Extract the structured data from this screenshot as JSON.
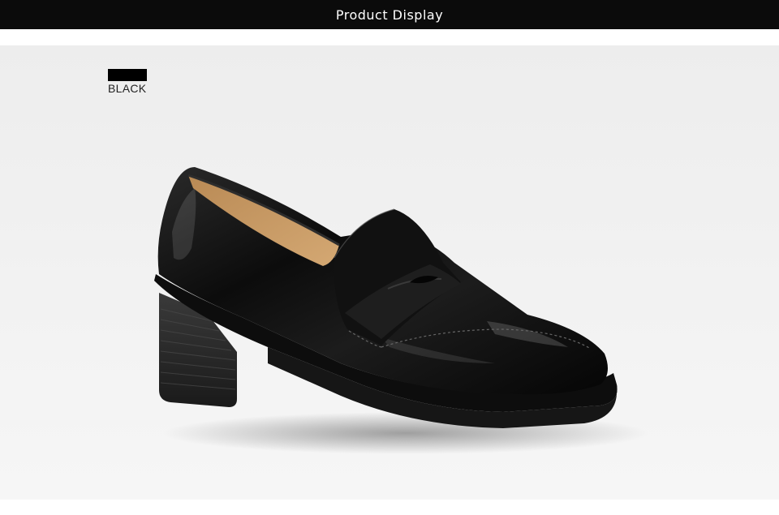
{
  "header": {
    "title": "Product Display"
  },
  "swatch": {
    "label": "BLACK",
    "color": "#000000"
  },
  "product": {
    "icon": "loafer-shoe-icon"
  }
}
